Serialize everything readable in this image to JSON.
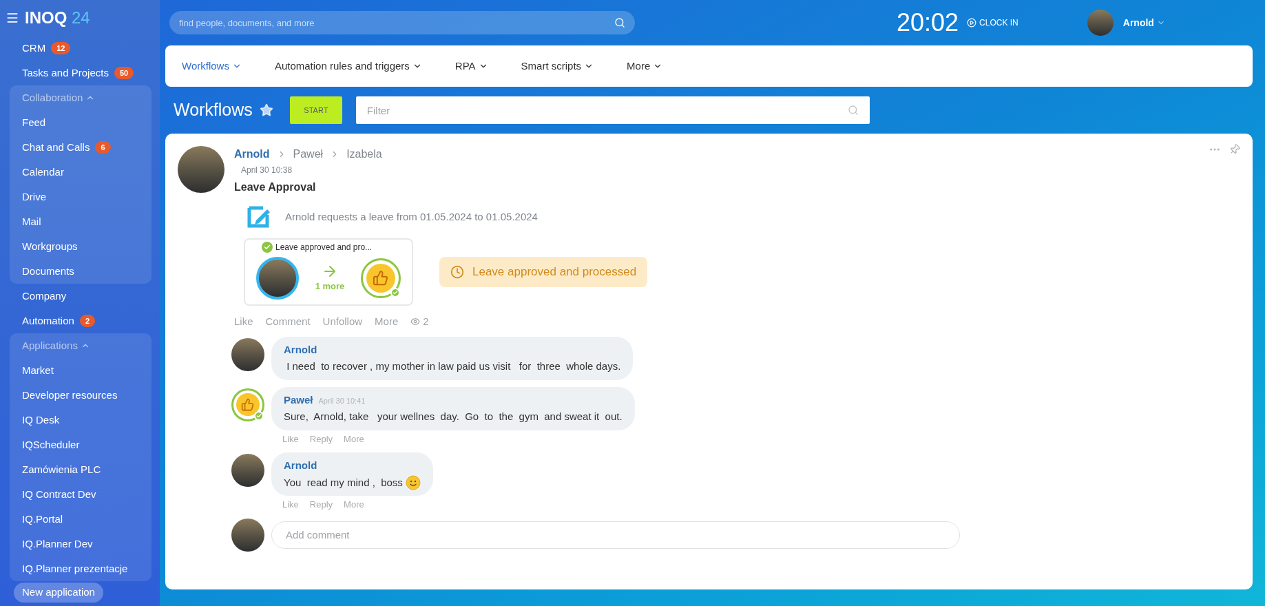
{
  "sidebar": {
    "logo": {
      "name": "INOQ",
      "number": "24"
    },
    "entries": [
      {
        "kind": "item",
        "label": "CRM",
        "badge": "12"
      },
      {
        "kind": "item",
        "label": "Tasks and Projects",
        "badge": "50"
      },
      {
        "kind": "group",
        "label": "Collaboration",
        "expanded": true,
        "children": [
          {
            "label": "Feed"
          },
          {
            "label": "Chat and Calls",
            "badge": "6"
          },
          {
            "label": "Calendar"
          },
          {
            "label": "Drive"
          },
          {
            "label": "Mail"
          },
          {
            "label": "Workgroups"
          },
          {
            "label": "Documents"
          }
        ]
      },
      {
        "kind": "item",
        "label": "Company"
      },
      {
        "kind": "item",
        "label": "Automation",
        "badge": "2"
      },
      {
        "kind": "group",
        "label": "Applications",
        "expanded": true,
        "children": [
          {
            "label": "Market"
          },
          {
            "label": "Developer resources"
          },
          {
            "label": "IQ Desk"
          },
          {
            "label": "IQScheduler"
          },
          {
            "label": "Zamówienia PLC"
          },
          {
            "label": "IQ Contract Dev"
          },
          {
            "label": "IQ.Portal"
          },
          {
            "label": "IQ.Planner Dev"
          },
          {
            "label": "IQ.Planner prezentacje"
          }
        ]
      }
    ],
    "new_button": "New application"
  },
  "header": {
    "search": {
      "placeholder": "find people, documents, and more"
    },
    "clock": "20:02",
    "clock_in": "CLOCK IN",
    "user": "Arnold"
  },
  "tabs": [
    {
      "label": "Workflows",
      "selected": true
    },
    {
      "label": "Automation rules and triggers",
      "selected": false
    },
    {
      "label": "RPA",
      "selected": false
    },
    {
      "label": "Smart scripts",
      "selected": false
    },
    {
      "label": "More",
      "selected": false
    }
  ],
  "page": {
    "title": "Workflows",
    "start": "START",
    "filter": {
      "placeholder": "Filter"
    }
  },
  "post": {
    "path": [
      "Arnold",
      "Paweł",
      "Izabela"
    ],
    "time": "April 30 10:38",
    "title": "Leave Approval",
    "request": "Arnold requests a leave from  01.05.2024 to 01.05.2024",
    "step": {
      "label": "Leave approved and pro...",
      "more": "1 more"
    },
    "status": "Leave approved and processed",
    "actions": [
      "Like",
      "Comment",
      "Unfollow",
      "More"
    ],
    "views": "2",
    "comments": [
      {
        "kind": "photo",
        "author": "Arnold",
        "text": " I need  to recover , my mother in law paid us visit   for  three  whole days.",
        "smiley": false
      },
      {
        "kind": "emoji",
        "author": "Paweł",
        "time": "April 30 10:41",
        "text": "Sure,  Arnold, take   your wellnes  day.  Go  to  the  gym  and sweat it  out.",
        "smiley": false,
        "actions": [
          "Like",
          "Reply",
          "More"
        ]
      },
      {
        "kind": "photo",
        "author": "Arnold",
        "text": "You  read my mind ,  boss",
        "smiley": true,
        "actions": [
          "Like",
          "Reply",
          "More"
        ]
      }
    ],
    "add_comment": {
      "placeholder": "Add comment"
    }
  }
}
